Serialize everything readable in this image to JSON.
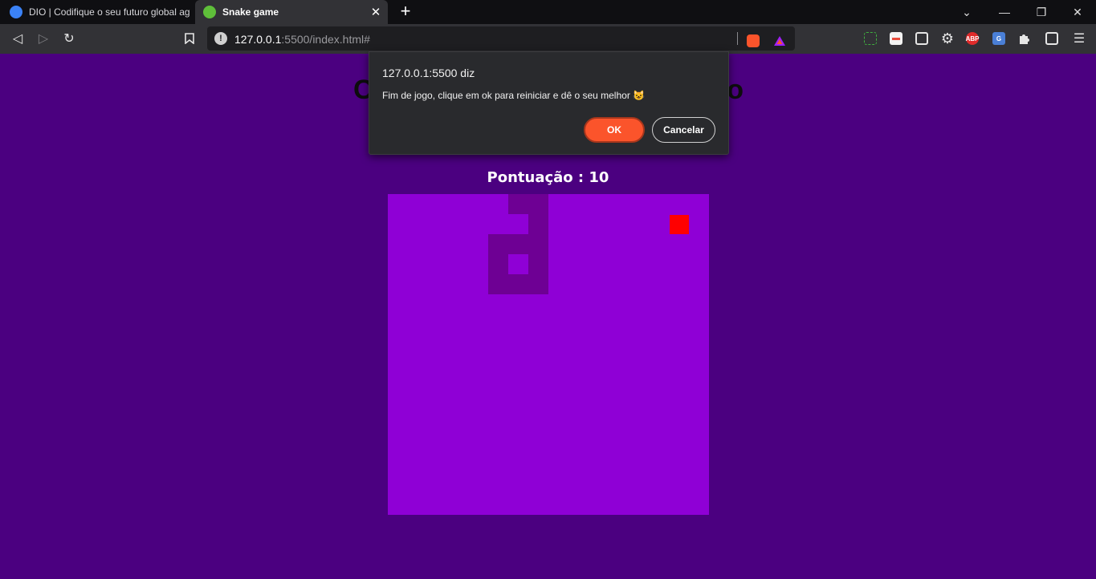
{
  "browser": {
    "tabs": [
      {
        "title": "DIO | Codifique o seu futuro global ag",
        "active": false
      },
      {
        "title": "Snake game",
        "active": true
      }
    ],
    "new_tab_symbol": "+",
    "url": {
      "host": "127.0.0.1",
      "rest": ":5500/index.html#"
    },
    "extensions": [
      "brave-shield-icon",
      "brave-rewards-icon",
      "screenshot-icon",
      "reader-icon",
      "pip-icon",
      "gear-icon",
      "adblock-plus-icon",
      "translate-icon",
      "puzzle-icon",
      "wallet-icon",
      "menu-icon"
    ],
    "adblock_label": "ABP"
  },
  "page": {
    "background": "#4b0080",
    "score_text": "Pontuação : 10",
    "board_color": "#8f00d6"
  },
  "game": {
    "grid_cells": 16,
    "snake_color": "#6e0094",
    "food_color": "#ff0000",
    "snake": [
      [
        6,
        0
      ],
      [
        7,
        0
      ],
      [
        7,
        1
      ],
      [
        7,
        2
      ],
      [
        7,
        3
      ],
      [
        7,
        4
      ],
      [
        6,
        4
      ],
      [
        5,
        4
      ],
      [
        5,
        3
      ],
      [
        5,
        2
      ],
      [
        6,
        2
      ]
    ],
    "food": [
      14,
      1
    ]
  },
  "dialog": {
    "title": "127.0.0.1:5500 diz",
    "message": "Fim de jogo, clique em ok para reiniciar e dê o seu melhor 😺",
    "ok_label": "OK",
    "cancel_label": "Cancelar"
  }
}
